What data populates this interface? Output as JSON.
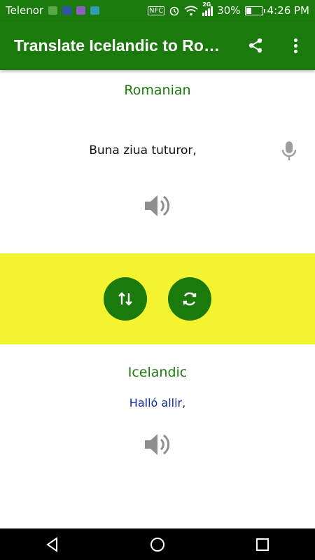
{
  "status_bar": {
    "carrier": "Telenor",
    "signal_type": "2G",
    "battery": "30%",
    "time": "4:26 PM",
    "icons": [
      "broom-icon",
      "app-icon",
      "gallery-icon",
      "screen-icon",
      "nfc-icon",
      "alarm-icon",
      "wifi-icon",
      "signal-icon",
      "battery-icon"
    ]
  },
  "app_bar": {
    "title": "Translate Icelandic to Romanian",
    "actions": [
      "share-icon",
      "more-vert-icon"
    ]
  },
  "source": {
    "language": "Romanian",
    "text": "Buna ziua tuturor,",
    "icons": [
      "microphone-icon",
      "speaker-icon"
    ]
  },
  "controls": {
    "buttons": [
      "swap-languages-icon",
      "refresh-icon"
    ],
    "band_color": "#f3f32f"
  },
  "target": {
    "language": "Icelandic",
    "text": "Halló allir,",
    "icons": [
      "speaker-icon"
    ]
  },
  "colors": {
    "primary": "#1b7a0c",
    "translated_text": "#0d2a9e"
  },
  "nav_bar": {
    "buttons": [
      "back-icon",
      "home-icon",
      "recents-icon"
    ]
  }
}
